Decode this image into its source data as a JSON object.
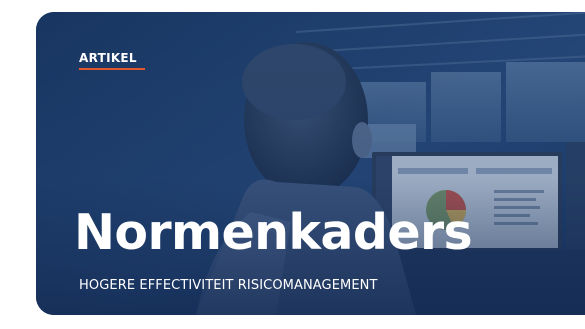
{
  "card": {
    "category": "ARTIKEL",
    "title": "Normenkaders",
    "subtitle": "HOGERE EFFECTIVITEIT RISICOMANAGEMENT",
    "accent_color": "#e0572e",
    "overlay_color": "#1e3f6e"
  }
}
